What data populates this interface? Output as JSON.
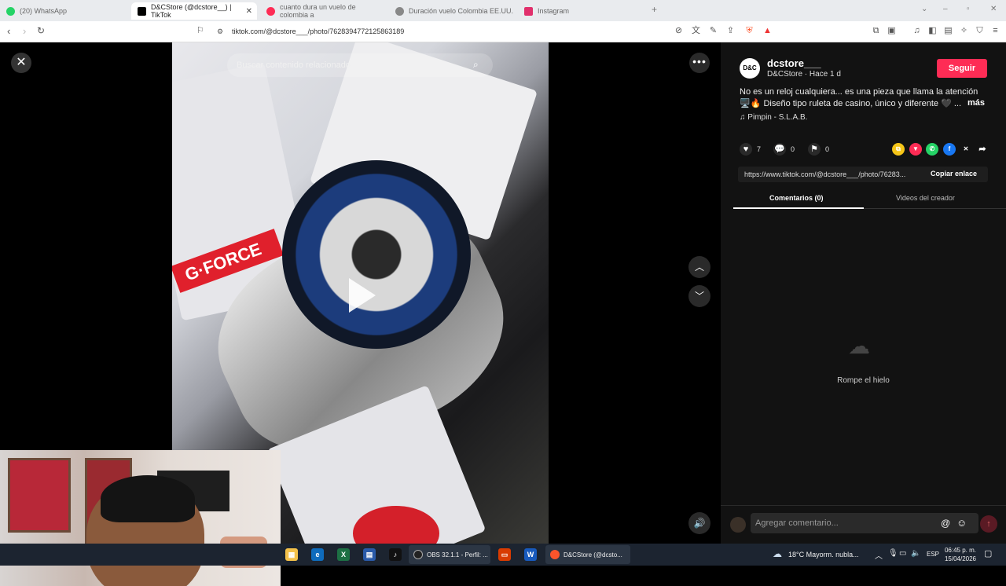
{
  "browser": {
    "tabs": [
      {
        "label": "(20) WhatsApp",
        "color": "#25d366"
      },
      {
        "label": "D&CStore (@dcstore__) | TikTok",
        "color": "#000000"
      },
      {
        "label": "cuanto dura un vuelo de colombia a",
        "color": "#fe2c55"
      },
      {
        "label": "Duración vuelo Colombia EE.UU.",
        "color": "#888888"
      },
      {
        "label": "Instagram",
        "color": "#e1306c"
      }
    ],
    "url": "tiktok.com/@dcstore___/photo/7628394772125863189"
  },
  "viewer": {
    "search_placeholder": "Buscar contenido relacionado",
    "brand_text": "G·FORCE"
  },
  "post": {
    "username": "dcstore___",
    "subtitle": "D&CStore · Hace 1 d",
    "follow_label": "Seguir",
    "description_line1": "No es un reloj cualquiera... es una pieza que llama la atención",
    "description_line2": "🖥️🔥 Diseño tipo ruleta de casino, único y diferente 🖤 ...",
    "more_label": "más",
    "music": "Pimpin - S.L.A.B.",
    "likes": "7",
    "comments": "0",
    "saves": "0",
    "link": "https://www.tiktok.com/@dcstore___/photo/76283...",
    "copy_label": "Copiar enlace",
    "tab_comments": "Comentarios (0)",
    "tab_videos": "Videos del creador",
    "empty_text": "Rompe el hielo",
    "comment_placeholder": "Agregar comentario..."
  },
  "taskbar": {
    "obs_label": "OBS 32.1.1 - Perfil: ...",
    "browser_label": "D&CStore (@dcsto...",
    "weather": "18°C  Mayorm. nubla...",
    "lang": "ESP",
    "time": "06:45 p. m.",
    "date": "15/04/2026"
  }
}
